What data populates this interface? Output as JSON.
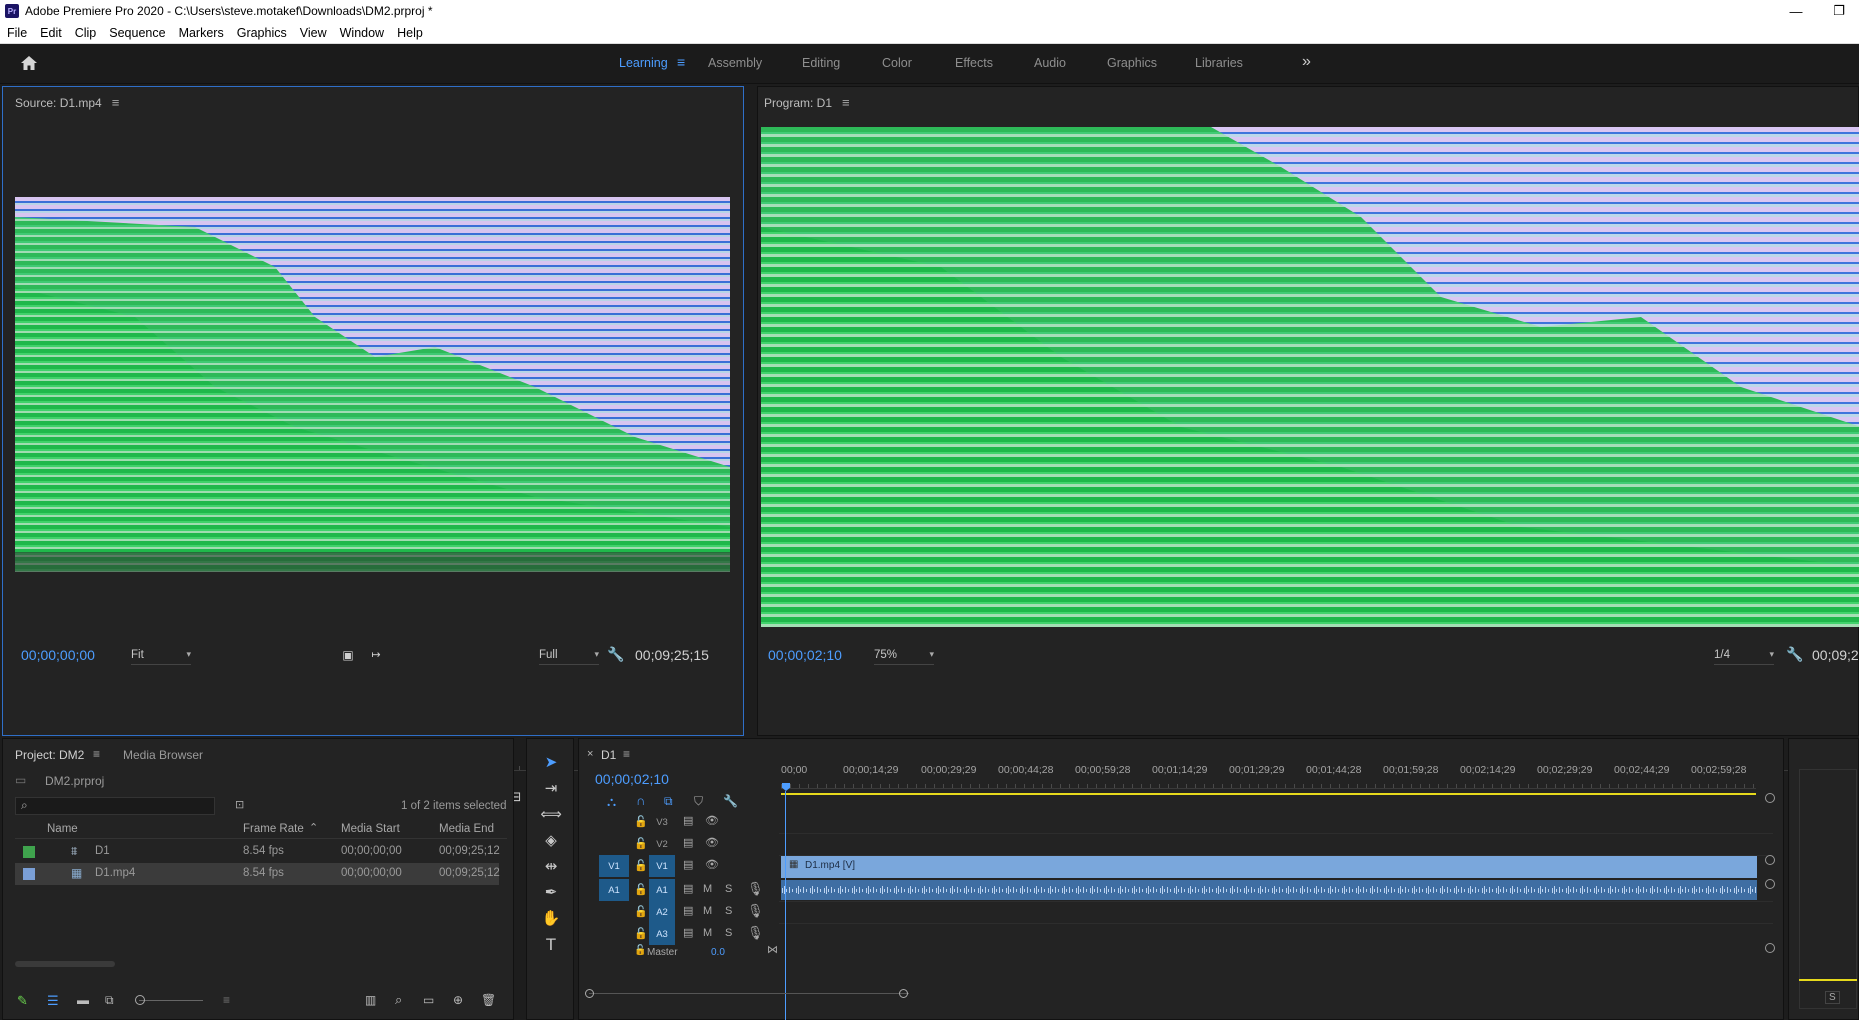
{
  "window": {
    "app_icon": "Pr",
    "title": "Adobe Premiere Pro 2020 - C:\\Users\\steve.motakef\\Downloads\\DM2.prproj *",
    "minimize": "—",
    "restore": "❐"
  },
  "menu": [
    "File",
    "Edit",
    "Clip",
    "Sequence",
    "Markers",
    "Graphics",
    "View",
    "Window",
    "Help"
  ],
  "workspaces": {
    "items": [
      "Learning",
      "Assembly",
      "Editing",
      "Color",
      "Effects",
      "Audio",
      "Graphics",
      "Libraries"
    ],
    "active": "Learning",
    "overflow": "»"
  },
  "source_monitor": {
    "title": "Source: D1.mp4",
    "timecode": "00;00;00;00",
    "fit": "Fit",
    "resolution": "Full",
    "duration": "00;09;25;15"
  },
  "program_monitor": {
    "title": "Program: D1",
    "timecode": "00;00;02;10",
    "zoom": "75%",
    "resolution": "1/4",
    "duration": "00;09;2"
  },
  "project": {
    "tab": "Project: DM2",
    "tab2": "Media Browser",
    "filename": "DM2.prproj",
    "selection": "1 of 2 items selected",
    "headers": {
      "name": "Name",
      "frame_rate": "Frame Rate",
      "media_start": "Media Start",
      "media_end": "Media End"
    },
    "items": [
      {
        "name": "D1",
        "frame_rate": "8.54 fps",
        "media_start": "00;00;00;00",
        "media_end": "00;09;25;12",
        "color": "#3fa34d"
      },
      {
        "name": "D1.mp4",
        "frame_rate": "8.54 fps",
        "media_start": "00;00;00;00",
        "media_end": "00;09;25;12",
        "color": "#7a9fd6"
      }
    ]
  },
  "timeline": {
    "tab": "D1",
    "timecode": "00;00;02;10",
    "ruler": [
      "00;00",
      "00;00;14;29",
      "00;00;29;29",
      "00;00;44;28",
      "00;00;59;28",
      "00;01;14;29",
      "00;01;29;29",
      "00;01;44;28",
      "00;01;59;28",
      "00;02;14;29",
      "00;02;29;29",
      "00;02;44;29",
      "00;02;59;28"
    ],
    "video_tracks": [
      "V3",
      "V2",
      "V1"
    ],
    "audio_tracks": [
      "A1",
      "A2",
      "A3"
    ],
    "source_patch_v": "V1",
    "source_patch_a": "A1",
    "clip_label": "D1.mp4 [V]",
    "master_label": "Master",
    "master_value": "0.0",
    "mute": "M",
    "solo": "S"
  },
  "audio_meter": {
    "label": "S"
  },
  "colors": {
    "accent": "#4d9dff",
    "clip_video": "#7aa7dc",
    "clip_audio": "#3f6ea3",
    "track_target": "#1e5a8a"
  }
}
